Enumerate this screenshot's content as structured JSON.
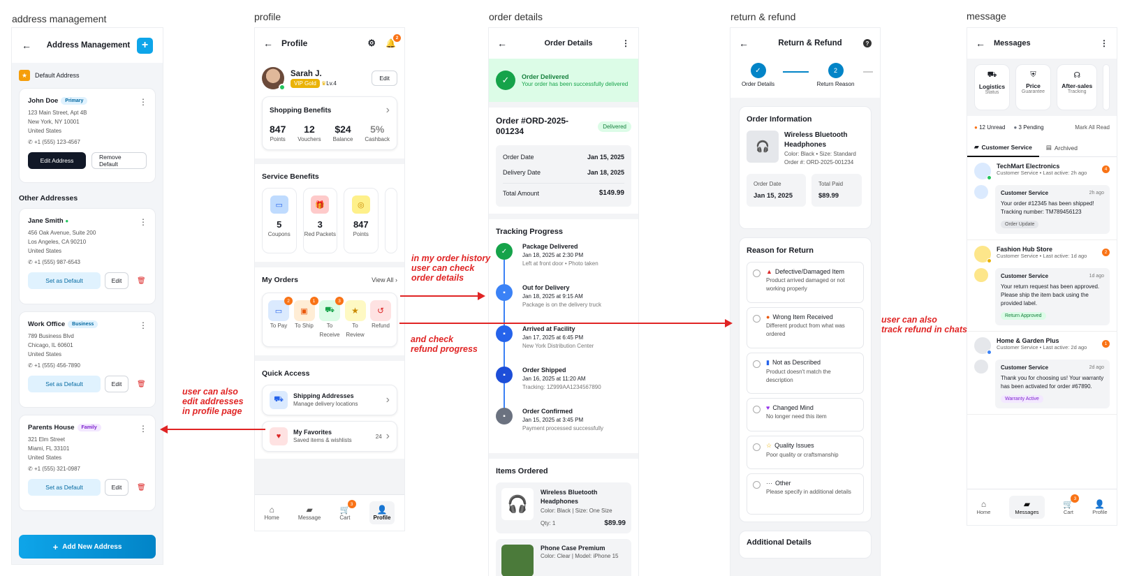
{
  "captions": {
    "address": "address management",
    "profile": "profile",
    "order": "order details",
    "return": "return & refund",
    "message": "message"
  },
  "annotations": {
    "history": "in my order history\nuser can check\norder details",
    "refund": "and check\nrefund progress",
    "chats": "user can also\ntrack refund in chats",
    "edit": "user can also\nedit addresses\nin profile page"
  },
  "address": {
    "title": "Address Management",
    "default_label": "Default Address",
    "primary": {
      "name": "John Doe",
      "tag": "Primary",
      "lines": [
        "123 Main Street, Apt 4B",
        "New York, NY 10001",
        "United States"
      ],
      "phone": "+1 (555) 123-4567",
      "edit": "Edit Address",
      "remove": "Remove Default"
    },
    "other_heading": "Other Addresses",
    "others": [
      {
        "name": "Jane Smith",
        "tag": "",
        "lines": [
          "456 Oak Avenue, Suite 200",
          "Los Angeles, CA 90210",
          "United States"
        ],
        "phone": "+1 (555) 987-6543"
      },
      {
        "name": "Work Office",
        "tag": "Business",
        "lines": [
          "789 Business Blvd",
          "Chicago, IL 60601",
          "United States"
        ],
        "phone": "+1 (555) 456-7890"
      },
      {
        "name": "Parents House",
        "tag": "Family",
        "lines": [
          "321 Elm Street",
          "Miami, FL 33101",
          "United States"
        ],
        "phone": "+1 (555) 321-0987"
      }
    ],
    "set_default": "Set as Default",
    "edit": "Edit",
    "add_button": "Add New Address"
  },
  "profile": {
    "title": "Profile",
    "notif_count": "2",
    "user": {
      "name": "Sarah J.",
      "vip": "VIP Gold",
      "level": "Lv.4",
      "edit": "Edit"
    },
    "benefits": {
      "title": "Shopping Benefits",
      "stats": [
        {
          "v": "847",
          "l": "Points"
        },
        {
          "v": "12",
          "l": "Vouchers"
        },
        {
          "v": "$24",
          "l": "Balance"
        },
        {
          "v": "5%",
          "l": "Cashback"
        }
      ]
    },
    "service": {
      "title": "Service Benefits",
      "items": [
        {
          "v": "5",
          "l": "Coupons"
        },
        {
          "v": "3",
          "l": "Red Packets"
        },
        {
          "v": "847",
          "l": "Points"
        }
      ]
    },
    "orders": {
      "title": "My Orders",
      "view_all": "View All",
      "items": [
        {
          "l": "To Pay",
          "b": "2"
        },
        {
          "l": "To Ship",
          "b": "1"
        },
        {
          "l": "To Receive",
          "b": "3"
        },
        {
          "l": "To Review",
          "b": ""
        },
        {
          "l": "Refund",
          "b": ""
        }
      ]
    },
    "quick": {
      "title": "Quick Access",
      "items": [
        {
          "t": "Shipping Addresses",
          "s": "Manage delivery locations",
          "c": ""
        },
        {
          "t": "My Favorites",
          "s": "Saved items & wishlists",
          "c": "24"
        }
      ]
    },
    "nav": [
      {
        "l": "Home"
      },
      {
        "l": "Message"
      },
      {
        "l": "Cart",
        "b": "3"
      },
      {
        "l": "Profile"
      }
    ]
  },
  "order": {
    "title": "Order Details",
    "status": {
      "title": "Order Delivered",
      "sub": "Your order has been successfully delivered"
    },
    "number": "Order #ORD-2025-001234",
    "badge": "Delivered",
    "rows": [
      {
        "k": "Order Date",
        "v": "Jan 15, 2025"
      },
      {
        "k": "Delivery Date",
        "v": "Jan 18, 2025"
      }
    ],
    "total": {
      "k": "Total Amount",
      "v": "$149.99"
    },
    "tracking_title": "Tracking Progress",
    "steps": [
      {
        "t": "Package Delivered",
        "d": "Jan 18, 2025 at 2:30 PM",
        "s": "Left at front door • Photo taken",
        "c": "#16a34a"
      },
      {
        "t": "Out for Delivery",
        "d": "Jan 18, 2025 at 9:15 AM",
        "s": "Package is on the delivery truck",
        "c": "#3b82f6"
      },
      {
        "t": "Arrived at Facility",
        "d": "Jan 17, 2025 at 6:45 PM",
        "s": "New York Distribution Center",
        "c": "#2563eb"
      },
      {
        "t": "Order Shipped",
        "d": "Jan 16, 2025 at 11:20 AM",
        "s": "Tracking: 1Z999AA1234567890",
        "c": "#1d4ed8"
      },
      {
        "t": "Order Confirmed",
        "d": "Jan 15, 2025 at 3:45 PM",
        "s": "Payment processed successfully",
        "c": "#6b7280"
      }
    ],
    "items_title": "Items Ordered",
    "items": [
      {
        "n": "Wireless Bluetooth Headphones",
        "m": "Color: Black | Size: One Size",
        "q": "Qty: 1",
        "p": "$89.99"
      },
      {
        "n": "Phone Case Premium",
        "m": "Color: Clear | Model: iPhone 15",
        "q": "",
        "p": ""
      }
    ]
  },
  "refund": {
    "title": "Return & Refund",
    "steps": [
      {
        "n": "✓",
        "l": "Order Details"
      },
      {
        "n": "2",
        "l": "Return Reason"
      }
    ],
    "info_title": "Order Information",
    "product": {
      "n": "Wireless Bluetooth Headphones",
      "m": "Color: Black • Size: Standard",
      "o": "Order #: ORD-2025-001234"
    },
    "date": {
      "k": "Order Date",
      "v": "Jan 15, 2025"
    },
    "paid": {
      "k": "Total Paid",
      "v": "$89.99"
    },
    "reason_title": "Reason for Return",
    "reasons": [
      {
        "t": "Defective/Damaged Item",
        "s": "Product arrived damaged or not working properly",
        "i": "▲",
        "c": "#dc2626"
      },
      {
        "t": "Wrong Item Received",
        "s": "Different product from what was ordered",
        "i": "●",
        "c": "#ea580c"
      },
      {
        "t": "Not as Described",
        "s": "Product doesn't match the description",
        "i": "▮",
        "c": "#2563eb"
      },
      {
        "t": "Changed Mind",
        "s": "No longer need this item",
        "i": "♥",
        "c": "#9333ea"
      },
      {
        "t": "Quality Issues",
        "s": "Poor quality or craftsmanship",
        "i": "☆",
        "c": "#eab308"
      },
      {
        "t": "Other",
        "s": "Please specify in additional details",
        "i": "···",
        "c": "#444"
      }
    ],
    "additional": "Additional Details"
  },
  "messages": {
    "title": "Messages",
    "cats": [
      {
        "t": "Logistics",
        "s": "Status"
      },
      {
        "t": "Price",
        "s": "Guarantee"
      },
      {
        "t": "After-sales",
        "s": "Tracking"
      }
    ],
    "unread": "12 Unread",
    "pending": "3 Pending",
    "mark": "Mark All Read",
    "tabs": [
      "Customer Service",
      "Archived"
    ],
    "threads": [
      {
        "n": "TechMart Electronics",
        "m": "Customer Service • Last active: 2h ago",
        "b": "4",
        "t": "2h ago",
        "body": "Your order #12345 has been shipped! Tracking number: TM789456123",
        "tag": "Order Update",
        "tagc": "#e5e7eb",
        "tagt": "#555"
      },
      {
        "n": "Fashion Hub Store",
        "m": "Customer Service • Last active: 1d ago",
        "b": "2",
        "t": "1d ago",
        "body": "Your return request has been approved. Please ship the item back using the provided label.",
        "tag": "Return Approved",
        "tagc": "#dcfce7",
        "tagt": "#15803d"
      },
      {
        "n": "Home & Garden Plus",
        "m": "Customer Service • Last active: 2d ago",
        "b": "1",
        "t": "2d ago",
        "body": "Thank you for choosing us! Your warranty has been activated for order #67890.",
        "tag": "Warranty Active",
        "tagc": "#f3e8ff",
        "tagt": "#7e22ce"
      }
    ],
    "cs": "Customer Service",
    "nav": [
      {
        "l": "Home"
      },
      {
        "l": "Messages"
      },
      {
        "l": "Cart",
        "b": "3"
      },
      {
        "l": "Profile"
      }
    ]
  }
}
